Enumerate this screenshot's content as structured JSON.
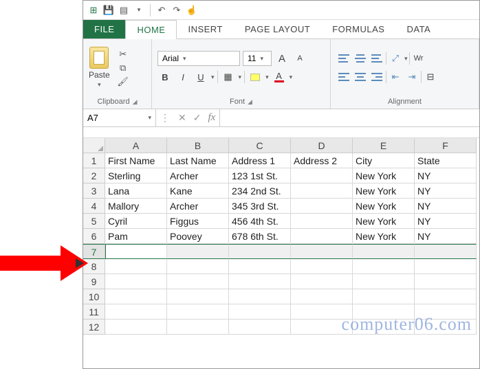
{
  "qat": {
    "excel_icon": "⊞",
    "save_icon": "💾",
    "props_icon": "▤",
    "undo_icon": "↶",
    "redo_icon": "↷"
  },
  "tabs": {
    "file": "FILE",
    "home": "HOME",
    "insert": "INSERT",
    "page_layout": "PAGE LAYOUT",
    "formulas": "FORMULAS",
    "data": "DATA"
  },
  "ribbon": {
    "clipboard": {
      "paste": "Paste",
      "label": "Clipboard",
      "cut_icon": "✂",
      "copy_icon": "⧉",
      "painter_icon": "🖌"
    },
    "font": {
      "name": "Arial",
      "size": "11",
      "grow": "A",
      "shrink": "A",
      "bold": "B",
      "italic": "I",
      "underline": "U",
      "fontcolor": "A",
      "label": "Font"
    },
    "alignment": {
      "wrap": "Wr",
      "label": "Alignment"
    }
  },
  "fxrow": {
    "namebox": "A7",
    "cancel": "✕",
    "enter": "✓",
    "fx": "fx",
    "formula": ""
  },
  "grid": {
    "cols": [
      "A",
      "B",
      "C",
      "D",
      "E",
      "F"
    ],
    "rows": [
      "1",
      "2",
      "3",
      "4",
      "5",
      "6",
      "7",
      "8",
      "9",
      "10",
      "11",
      "12"
    ],
    "selected_row": 7,
    "data": [
      [
        "First Name",
        "Last Name",
        "Address 1",
        "Address 2",
        "City",
        "State"
      ],
      [
        "Sterling",
        "Archer",
        "123 1st St.",
        "",
        "New York",
        "NY"
      ],
      [
        "Lana",
        "Kane",
        "234 2nd St.",
        "",
        "New York",
        "NY"
      ],
      [
        "Mallory",
        "Archer",
        "345 3rd St.",
        "",
        "New York",
        "NY"
      ],
      [
        "Cyril",
        "Figgus",
        "456 4th St.",
        "",
        "New York",
        "NY"
      ],
      [
        "Pam",
        "Poovey",
        "678 6th St.",
        "",
        "New York",
        "NY"
      ],
      [
        "",
        "",
        "",
        "",
        "",
        ""
      ],
      [
        "",
        "",
        "",
        "",
        "",
        ""
      ],
      [
        "",
        "",
        "",
        "",
        "",
        ""
      ],
      [
        "",
        "",
        "",
        "",
        "",
        ""
      ],
      [
        "",
        "",
        "",
        "",
        "",
        ""
      ],
      [
        "",
        "",
        "",
        "",
        "",
        ""
      ]
    ]
  },
  "watermark": "computer06.com"
}
